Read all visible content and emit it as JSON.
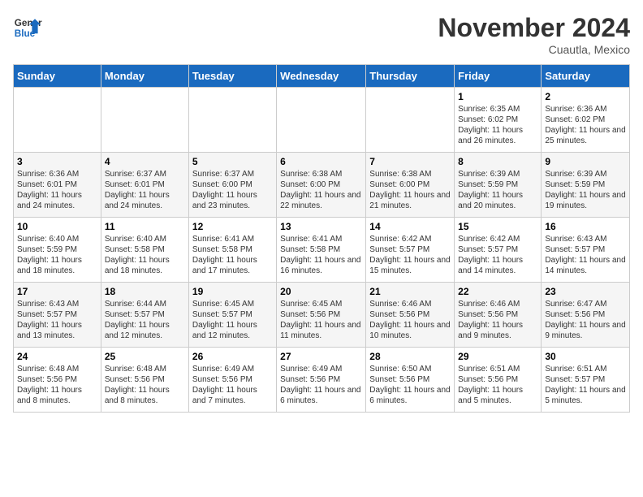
{
  "logo": {
    "text_general": "General",
    "text_blue": "Blue"
  },
  "header": {
    "title": "November 2024",
    "subtitle": "Cuautla, Mexico"
  },
  "weekdays": [
    "Sunday",
    "Monday",
    "Tuesday",
    "Wednesday",
    "Thursday",
    "Friday",
    "Saturday"
  ],
  "weeks": [
    [
      {
        "day": "",
        "info": ""
      },
      {
        "day": "",
        "info": ""
      },
      {
        "day": "",
        "info": ""
      },
      {
        "day": "",
        "info": ""
      },
      {
        "day": "",
        "info": ""
      },
      {
        "day": "1",
        "info": "Sunrise: 6:35 AM\nSunset: 6:02 PM\nDaylight: 11 hours and 26 minutes."
      },
      {
        "day": "2",
        "info": "Sunrise: 6:36 AM\nSunset: 6:02 PM\nDaylight: 11 hours and 25 minutes."
      }
    ],
    [
      {
        "day": "3",
        "info": "Sunrise: 6:36 AM\nSunset: 6:01 PM\nDaylight: 11 hours and 24 minutes."
      },
      {
        "day": "4",
        "info": "Sunrise: 6:37 AM\nSunset: 6:01 PM\nDaylight: 11 hours and 24 minutes."
      },
      {
        "day": "5",
        "info": "Sunrise: 6:37 AM\nSunset: 6:00 PM\nDaylight: 11 hours and 23 minutes."
      },
      {
        "day": "6",
        "info": "Sunrise: 6:38 AM\nSunset: 6:00 PM\nDaylight: 11 hours and 22 minutes."
      },
      {
        "day": "7",
        "info": "Sunrise: 6:38 AM\nSunset: 6:00 PM\nDaylight: 11 hours and 21 minutes."
      },
      {
        "day": "8",
        "info": "Sunrise: 6:39 AM\nSunset: 5:59 PM\nDaylight: 11 hours and 20 minutes."
      },
      {
        "day": "9",
        "info": "Sunrise: 6:39 AM\nSunset: 5:59 PM\nDaylight: 11 hours and 19 minutes."
      }
    ],
    [
      {
        "day": "10",
        "info": "Sunrise: 6:40 AM\nSunset: 5:59 PM\nDaylight: 11 hours and 18 minutes."
      },
      {
        "day": "11",
        "info": "Sunrise: 6:40 AM\nSunset: 5:58 PM\nDaylight: 11 hours and 18 minutes."
      },
      {
        "day": "12",
        "info": "Sunrise: 6:41 AM\nSunset: 5:58 PM\nDaylight: 11 hours and 17 minutes."
      },
      {
        "day": "13",
        "info": "Sunrise: 6:41 AM\nSunset: 5:58 PM\nDaylight: 11 hours and 16 minutes."
      },
      {
        "day": "14",
        "info": "Sunrise: 6:42 AM\nSunset: 5:57 PM\nDaylight: 11 hours and 15 minutes."
      },
      {
        "day": "15",
        "info": "Sunrise: 6:42 AM\nSunset: 5:57 PM\nDaylight: 11 hours and 14 minutes."
      },
      {
        "day": "16",
        "info": "Sunrise: 6:43 AM\nSunset: 5:57 PM\nDaylight: 11 hours and 14 minutes."
      }
    ],
    [
      {
        "day": "17",
        "info": "Sunrise: 6:43 AM\nSunset: 5:57 PM\nDaylight: 11 hours and 13 minutes."
      },
      {
        "day": "18",
        "info": "Sunrise: 6:44 AM\nSunset: 5:57 PM\nDaylight: 11 hours and 12 minutes."
      },
      {
        "day": "19",
        "info": "Sunrise: 6:45 AM\nSunset: 5:57 PM\nDaylight: 11 hours and 12 minutes."
      },
      {
        "day": "20",
        "info": "Sunrise: 6:45 AM\nSunset: 5:56 PM\nDaylight: 11 hours and 11 minutes."
      },
      {
        "day": "21",
        "info": "Sunrise: 6:46 AM\nSunset: 5:56 PM\nDaylight: 11 hours and 10 minutes."
      },
      {
        "day": "22",
        "info": "Sunrise: 6:46 AM\nSunset: 5:56 PM\nDaylight: 11 hours and 9 minutes."
      },
      {
        "day": "23",
        "info": "Sunrise: 6:47 AM\nSunset: 5:56 PM\nDaylight: 11 hours and 9 minutes."
      }
    ],
    [
      {
        "day": "24",
        "info": "Sunrise: 6:48 AM\nSunset: 5:56 PM\nDaylight: 11 hours and 8 minutes."
      },
      {
        "day": "25",
        "info": "Sunrise: 6:48 AM\nSunset: 5:56 PM\nDaylight: 11 hours and 8 minutes."
      },
      {
        "day": "26",
        "info": "Sunrise: 6:49 AM\nSunset: 5:56 PM\nDaylight: 11 hours and 7 minutes."
      },
      {
        "day": "27",
        "info": "Sunrise: 6:49 AM\nSunset: 5:56 PM\nDaylight: 11 hours and 6 minutes."
      },
      {
        "day": "28",
        "info": "Sunrise: 6:50 AM\nSunset: 5:56 PM\nDaylight: 11 hours and 6 minutes."
      },
      {
        "day": "29",
        "info": "Sunrise: 6:51 AM\nSunset: 5:56 PM\nDaylight: 11 hours and 5 minutes."
      },
      {
        "day": "30",
        "info": "Sunrise: 6:51 AM\nSunset: 5:57 PM\nDaylight: 11 hours and 5 minutes."
      }
    ]
  ]
}
